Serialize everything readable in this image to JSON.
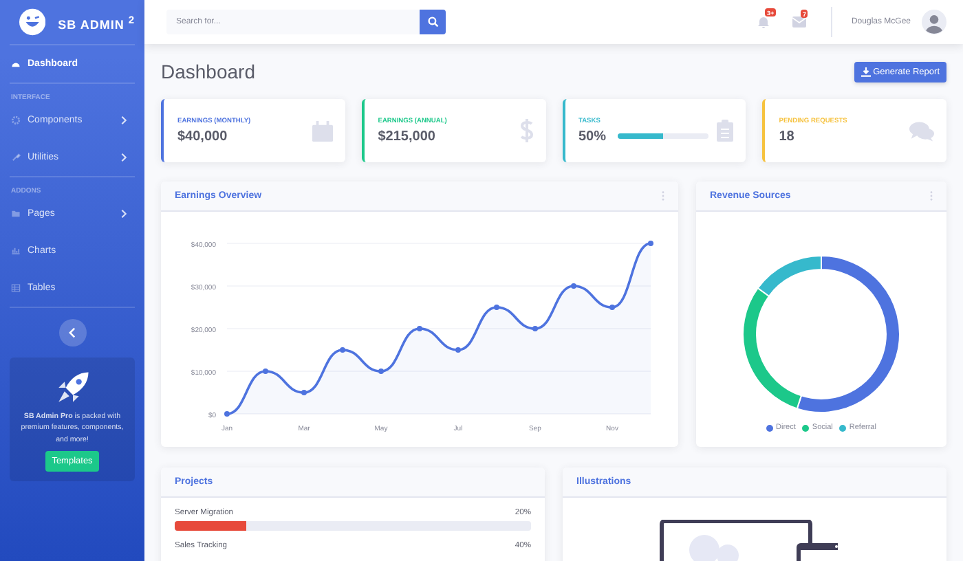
{
  "sidebar": {
    "brand": "SB ADMIN $^{2}$",
    "sections": [
      {
        "items": [
          {
            "label": "Dashboard",
            "selected": true,
            "collapsible": false
          }
        ]
      },
      {
        "heading": "INTERFACE",
        "items": [
          {
            "label": "Components",
            "selected": false,
            "collapsible": true
          },
          {
            "label": "Utilities",
            "selected": false,
            "collapsible": true
          }
        ]
      },
      {
        "heading": "ADDONS",
        "items": [
          {
            "label": "Pages",
            "selected": false,
            "collapsible": true
          },
          {
            "label": "Charts",
            "selected": false,
            "collapsible": false
          },
          {
            "label": "Tables",
            "selected": false,
            "collapsible": false
          }
        ]
      }
    ],
    "promo": {
      "text": "**SB Admin Pro** is packed with premium features, components, and more!",
      "button": "Templates"
    }
  },
  "topbar": {
    "search": {
      "placeholder": "Search for..."
    },
    "alerts_badge": "3+",
    "messages_badge": "7",
    "user_name": "Douglas McGee"
  },
  "page_title": "Dashboard",
  "report_button": "Generate Report",
  "stat_cards": [
    {
      "label": "EARNINGS (MONTHLY)",
      "value": "$40,000",
      "color": "#4e73df"
    },
    {
      "label": "EARNINGS (ANNUAL)",
      "value": "$215,000",
      "color": "#1cc88a"
    },
    {
      "label": "TASKS",
      "value": "50%",
      "color": "#36b9cc",
      "level": 0.5
    },
    {
      "label": "PENDING REQUESTS",
      "value": "18",
      "color": "#f6c23e"
    }
  ],
  "earnings_overview": {
    "title": "Earnings Overview",
    "chart_data": {
      "type": "area",
      "grid": true,
      "categories": [
        "Jan",
        null,
        "Mar",
        null,
        "May",
        null,
        "Jul",
        null,
        "Sep",
        null,
        "Nov",
        null
      ],
      "series": [
        {
          "color": "#4e73df",
          "values": [
            0,
            10000,
            5000,
            15000,
            10000,
            20000,
            15000,
            25000,
            20000,
            30000,
            25000,
            40000
          ]
        }
      ],
      "ylim": [
        0,
        40000
      ],
      "yticks": [
        {
          "value": 0,
          "label": "$0"
        },
        {
          "value": 10000,
          "label": "$10,000"
        },
        {
          "value": 20000,
          "label": "$20,000"
        },
        {
          "value": 30000,
          "label": "$30,000"
        },
        {
          "value": 40000,
          "label": "$40,000"
        }
      ]
    }
  },
  "revenue_sources": {
    "title": "Revenue Sources",
    "chart_data": {
      "type": "donut",
      "legend": "bottom",
      "categories": [
        "Direct",
        "Social",
        "Referral"
      ],
      "values": [
        55,
        30,
        15
      ],
      "colors": [
        "#4e73df",
        "#1cc88a",
        "#36b9cc"
      ]
    }
  },
  "projects": {
    "title": "Projects",
    "items": [
      {
        "name": "Server Migration",
        "percent": "20%",
        "level": 0.2,
        "color": "#e74a3b"
      },
      {
        "name": "Sales Tracking",
        "percent": "40%"
      }
    ]
  },
  "illustrations": {
    "title": "Illustrations"
  }
}
